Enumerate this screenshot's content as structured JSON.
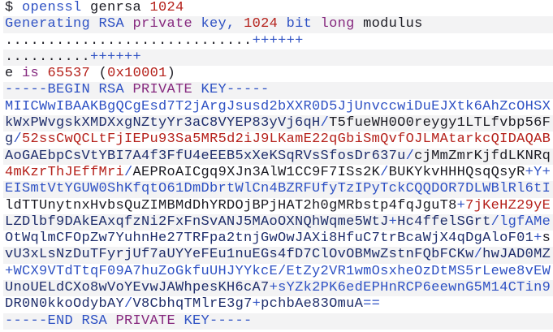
{
  "terminal": {
    "lines": [
      [
        {
          "t": "$ ",
          "c": "dark"
        },
        {
          "t": "openssl",
          "c": "blue"
        },
        {
          "t": " genrsa ",
          "c": "dark"
        },
        {
          "t": "1024",
          "c": "red"
        }
      ],
      [
        {
          "t": "Generating RSA ",
          "c": "blue"
        },
        {
          "t": "private",
          "c": "purple"
        },
        {
          "t": " key, ",
          "c": "blue"
        },
        {
          "t": "1024",
          "c": "red"
        },
        {
          "t": " bit ",
          "c": "blue"
        },
        {
          "t": "long",
          "c": "purple"
        },
        {
          "t": " modulus",
          "c": "dark"
        }
      ],
      [
        {
          "t": ".............................",
          "c": "dark"
        },
        {
          "t": "++++++",
          "c": "blue"
        }
      ],
      [
        {
          "t": "..........",
          "c": "dark"
        },
        {
          "t": "++++++",
          "c": "blue"
        }
      ],
      [
        {
          "t": "e ",
          "c": "dark"
        },
        {
          "t": "is",
          "c": "purple"
        },
        {
          "t": " ",
          "c": "dark"
        },
        {
          "t": "65537",
          "c": "red"
        },
        {
          "t": " (",
          "c": "dark"
        },
        {
          "t": "0x10001",
          "c": "red"
        },
        {
          "t": ")",
          "c": "dark"
        }
      ],
      [
        {
          "t": "-----BEGIN RSA ",
          "c": "blue"
        },
        {
          "t": "PRIVATE",
          "c": "purple"
        },
        {
          "t": " KEY-----",
          "c": "blue"
        }
      ],
      [
        {
          "t": "MIICWwIBAAKBgQCgEsd7T2jArgJsusd2bXXR0D5JjUnvccwiDuEJXtk6AhZcOHSX",
          "c": "blue"
        }
      ],
      [
        {
          "t": "kWxPWvgskXMDXxgNZtyYr3aC8VYEP83yVj6qH",
          "c": "navy"
        },
        {
          "t": "/",
          "c": "blue"
        },
        {
          "t": "T5fueWH0O0reygy1LTLfvbp56F",
          "c": "dark"
        }
      ],
      [
        {
          "t": "g",
          "c": "navy"
        },
        {
          "t": "/",
          "c": "blue"
        },
        {
          "t": "52ssCwQCLtFjIEPu93Sa5MR5d2iJ9LKamE22qGbiSmQvfOJLMAtarkcQIDAQAB",
          "c": "red"
        }
      ],
      [
        {
          "t": "AoGAEbpCsVtYBI7A4f3FfU4eEEB5xXeKSqRVsSfosDr637u",
          "c": "navy"
        },
        {
          "t": "/",
          "c": "blue"
        },
        {
          "t": "cjMmZmrKjfdLKNRq",
          "c": "dark"
        }
      ],
      [
        {
          "t": "4mKzrThJEffMri",
          "c": "red"
        },
        {
          "t": "/",
          "c": "blue"
        },
        {
          "t": "AEPRoAICgq9XJn3AlW1CC9F7ISs2K",
          "c": "dark"
        },
        {
          "t": "/",
          "c": "blue"
        },
        {
          "t": "BUKYkvHHHQsqQsyR",
          "c": "dark"
        },
        {
          "t": "+Y+",
          "c": "blue"
        }
      ],
      [
        {
          "t": "EISmtVtYGUW0ShKfqtO61DmDbrtWlCn4BZRFUfyTzIPyTckCQQDOR7DLWBlRl6tI",
          "c": "blue"
        }
      ],
      [
        {
          "t": "ldTTUnytnxHvbsQuZIMBMdDhYRDOjBPjHAT2h0gMRbstp4fqJguT8",
          "c": "dark"
        },
        {
          "t": "+",
          "c": "blue"
        },
        {
          "t": "7jKeHZ29yE",
          "c": "red"
        }
      ],
      [
        {
          "t": "LZDlbf9DAkEAxqfzNi2FxFnSvANJ5MAoOXNQhWqme5WtJ",
          "c": "navy"
        },
        {
          "t": "+",
          "c": "blue"
        },
        {
          "t": "Hc4ffelSGrt",
          "c": "navy"
        },
        {
          "t": "/lgfAMe",
          "c": "blue"
        }
      ],
      [
        {
          "t": "OtWqlmCFOpZw7YuhnHe27TRFpa2tnjGwOwJAXi8HfuC7trBcaWjX4qDgAloF01",
          "c": "navy"
        },
        {
          "t": "+",
          "c": "blue"
        },
        {
          "t": "s",
          "c": "dark"
        }
      ],
      [
        {
          "t": "vU3xLsNzDuTFyrjUf7aUYYeFEu1nuEGs4fD7ClOvOBMwZstnFQbFCKw",
          "c": "navy"
        },
        {
          "t": "/",
          "c": "blue"
        },
        {
          "t": "hwJAD0MZ",
          "c": "navy"
        }
      ],
      [
        {
          "t": "+WCX9VTdTtqF09A7huZoGkfuUHJYYkcE/EtZy2VR1wmOsxheOzDtMS5rLewe8vEW",
          "c": "blue"
        }
      ],
      [
        {
          "t": "UnoUELdCXo8wVoYEvwJAWhpesKH6cA7",
          "c": "navy"
        },
        {
          "t": "+sYZk2PK6edEPHnRCP6eewnG5M14CTin9",
          "c": "blue"
        }
      ],
      [
        {
          "t": "DR0N0kkoOdybAY",
          "c": "navy"
        },
        {
          "t": "/",
          "c": "blue"
        },
        {
          "t": "V8CbhqTMlrE3g7",
          "c": "navy"
        },
        {
          "t": "+",
          "c": "blue"
        },
        {
          "t": "pchbAe83OmuA",
          "c": "navy"
        },
        {
          "t": "==",
          "c": "blue"
        }
      ],
      [
        {
          "t": "-----END RSA ",
          "c": "blue"
        },
        {
          "t": "PRIVATE",
          "c": "purple"
        },
        {
          "t": " KEY-----",
          "c": "blue"
        }
      ]
    ]
  }
}
